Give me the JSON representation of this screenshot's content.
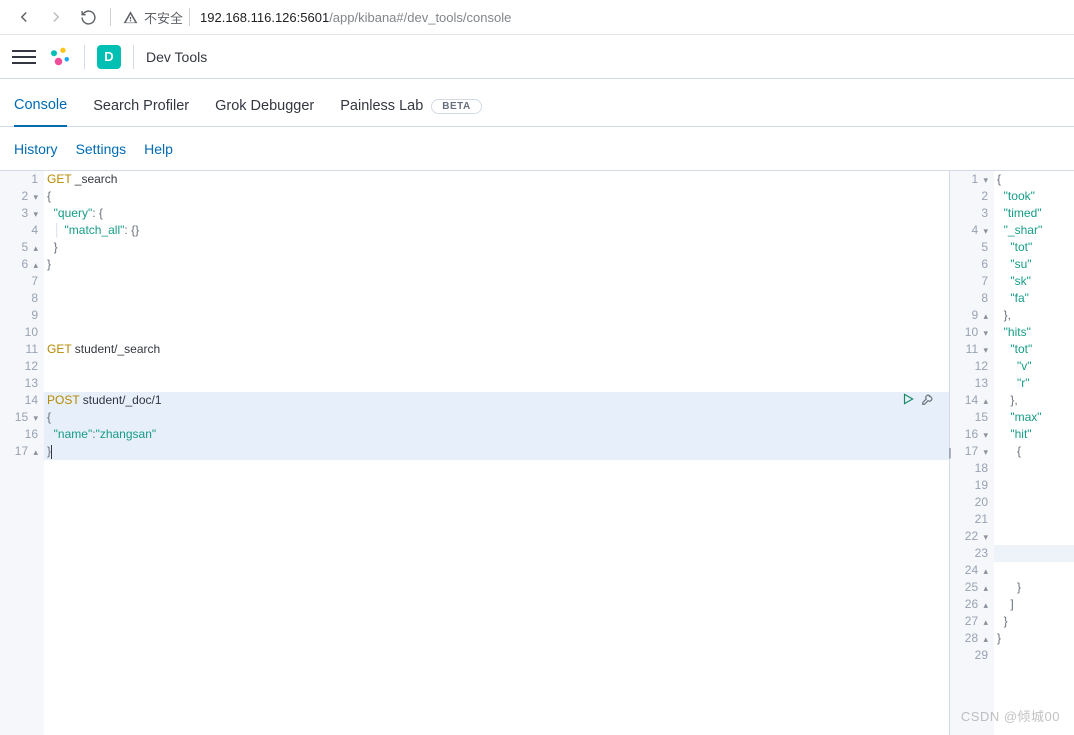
{
  "browser": {
    "insecure_label": "不安全",
    "url_host_port": "192.168.116.126:5601",
    "url_path": "/app/kibana#/dev_tools/console"
  },
  "header": {
    "app_badge_letter": "D",
    "app_name": "Dev Tools"
  },
  "tabs": [
    {
      "label": "Console",
      "active": true
    },
    {
      "label": "Search Profiler",
      "active": false
    },
    {
      "label": "Grok Debugger",
      "active": false
    },
    {
      "label": "Painless Lab",
      "active": false,
      "badge": "BETA"
    }
  ],
  "subnav": [
    {
      "label": "History"
    },
    {
      "label": "Settings"
    },
    {
      "label": "Help"
    }
  ],
  "editor": {
    "lines": [
      {
        "n": 1,
        "method": "GET",
        "path": "_search"
      },
      {
        "n": 2,
        "fold": "▾",
        "text": "{"
      },
      {
        "n": 3,
        "fold": "▾",
        "indent": 1,
        "key": "query",
        "after": ": {"
      },
      {
        "n": 4,
        "indent": 1,
        "guide": true,
        "key": "match_all",
        "after": ": {}"
      },
      {
        "n": 5,
        "fold": "▴",
        "indent": 1,
        "text": "}"
      },
      {
        "n": 6,
        "fold": "▴",
        "text": "}"
      },
      {
        "n": 7
      },
      {
        "n": 8
      },
      {
        "n": 9
      },
      {
        "n": 10
      },
      {
        "n": 11,
        "method": "GET",
        "path": "student/_search"
      },
      {
        "n": 12
      },
      {
        "n": 13
      },
      {
        "n": 14,
        "hl": true,
        "method": "POST",
        "path": "student/_doc/1"
      },
      {
        "n": 15,
        "hl": true,
        "fold": "▾",
        "text": "{"
      },
      {
        "n": 16,
        "hl": true,
        "indent": 1,
        "key": "name",
        "strval": "zhangsan"
      },
      {
        "n": 17,
        "hl": true,
        "fold": "▴",
        "text": "}",
        "cursor": true
      }
    ]
  },
  "output": {
    "lines": [
      {
        "n": 1,
        "fold": "▾",
        "text": "{"
      },
      {
        "n": 2,
        "indent": 1,
        "key": "took"
      },
      {
        "n": 3,
        "indent": 1,
        "key": "timed"
      },
      {
        "n": 4,
        "fold": "▾",
        "indent": 1,
        "key": "_shar"
      },
      {
        "n": 5,
        "indent": 2,
        "key": "tot"
      },
      {
        "n": 6,
        "indent": 2,
        "key": "su"
      },
      {
        "n": 7,
        "indent": 2,
        "key": "sk"
      },
      {
        "n": 8,
        "indent": 2,
        "key": "fa"
      },
      {
        "n": 9,
        "fold": "▴",
        "indent": 1,
        "text": "},"
      },
      {
        "n": 10,
        "fold": "▾",
        "indent": 1,
        "key": "hits"
      },
      {
        "n": 11,
        "fold": "▾",
        "indent": 2,
        "key": "tot"
      },
      {
        "n": 12,
        "indent": 3,
        "key": "v"
      },
      {
        "n": 13,
        "indent": 3,
        "key": "r"
      },
      {
        "n": 14,
        "fold": "▴",
        "indent": 2,
        "text": "},"
      },
      {
        "n": 15,
        "indent": 2,
        "key": "max"
      },
      {
        "n": 16,
        "fold": "▾",
        "indent": 2,
        "key": "hit"
      },
      {
        "n": 17,
        "fold": "▾",
        "indent": 3,
        "text": "{"
      },
      {
        "n": 18,
        "indent": 3
      },
      {
        "n": 19,
        "indent": 3
      },
      {
        "n": 20,
        "indent": 3
      },
      {
        "n": 21,
        "indent": 3
      },
      {
        "n": 22,
        "fold": "▾",
        "indent": 3
      },
      {
        "n": 23,
        "out_hl": true,
        "indent": 3
      },
      {
        "n": 24,
        "fold": "▴",
        "indent": 3
      },
      {
        "n": 25,
        "fold": "▴",
        "indent": 3,
        "text": "}"
      },
      {
        "n": 26,
        "fold": "▴",
        "indent": 2,
        "text": "]"
      },
      {
        "n": 27,
        "fold": "▴",
        "indent": 1,
        "text": "}"
      },
      {
        "n": 28,
        "fold": "▴",
        "text": "}"
      },
      {
        "n": 29
      }
    ]
  },
  "watermark": "CSDN @倾城00"
}
